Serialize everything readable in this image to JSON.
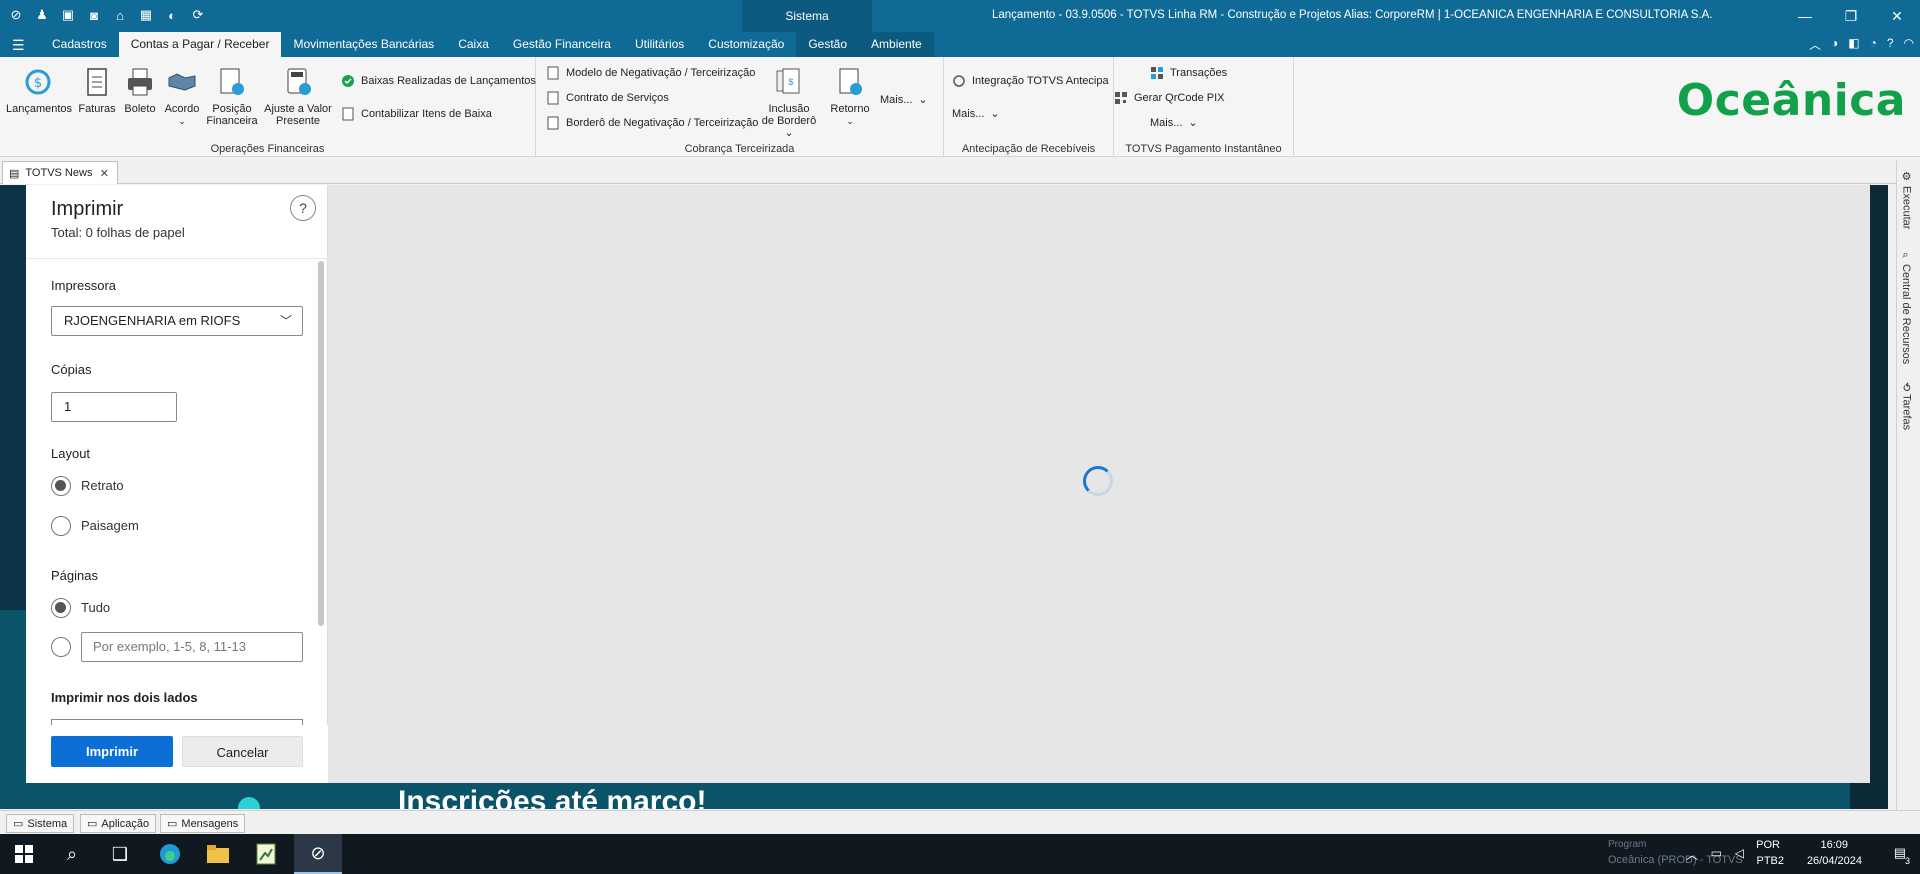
{
  "titlebar": {
    "sistema_label": "Sistema",
    "window_title": "Lançamento - 03.9.0506 - TOTVS Linha RM - Construção e Projetos  Alias: CorporeRM | 1-OCEANICA ENGENHARIA E CONSULTORIA S.A."
  },
  "menu": {
    "tabs": [
      "Cadastros",
      "Contas a Pagar / Receber",
      "Movimentações Bancárias",
      "Caixa",
      "Gestão Financeira",
      "Utilitários",
      "Customização",
      "Gestão",
      "Ambiente"
    ],
    "active_tab": "Contas a Pagar / Receber"
  },
  "ribbon": {
    "operacoes": {
      "title": "Operações Financeiras",
      "lancamentos": "Lançamentos",
      "faturas": "Faturas",
      "boleto": "Boleto",
      "acordo": "Acordo",
      "posicao_1": "Posição",
      "posicao_2": "Financeira",
      "ajuste_1": "Ajuste a Valor",
      "ajuste_2": "Presente",
      "baixas": "Baixas Realizadas de Lançamentos",
      "contabilizar": "Contabilizar Itens de Baixa"
    },
    "cobranca": {
      "title": "Cobrança Terceirizada",
      "modelo": "Modelo de Negativação / Terceirização",
      "contrato": "Contrato de Serviços",
      "bordero_neg": "Borderô de Negativação / Terceirização",
      "inclusao_1": "Inclusão",
      "inclusao_2": "de Borderô",
      "retorno": "Retorno",
      "mais": "Mais..."
    },
    "antecipacao": {
      "title": "Antecipação de Recebíveis",
      "integracao": "Integração TOTVS Antecipa",
      "mais": "Mais..."
    },
    "pix": {
      "title": "TOTVS Pagamento Instantâneo",
      "transacoes": "Transações",
      "qrcode": "Gerar QrCode PIX",
      "mais": "Mais..."
    },
    "logo": "Oceânica"
  },
  "doc_tab": {
    "label": "TOTVS News"
  },
  "background": {
    "banner_text": "Inscrições até março!"
  },
  "print_dialog": {
    "title": "Imprimir",
    "subtitle": "Total: 0 folhas de papel",
    "help": "?",
    "printer_label": "Impressora",
    "printer_value": "RJOENGENHARIA em RIOFS",
    "copies_label": "Cópias",
    "copies_value": "1",
    "layout_label": "Layout",
    "layout_portrait": "Retrato",
    "layout_landscape": "Paisagem",
    "layout_selected": "Retrato",
    "pages_label": "Páginas",
    "pages_all": "Tudo",
    "pages_placeholder": "Por exemplo, 1-5, 8, 11-13",
    "duplex_label": "Imprimir nos dois lados",
    "print_button": "Imprimir",
    "cancel_button": "Cancelar"
  },
  "right_rail": [
    "Executar",
    "Central de Recursos",
    "Tarefas"
  ],
  "statusbar": {
    "tabs": [
      "Sistema",
      "Aplicação",
      "Mensagens"
    ]
  },
  "taskbar": {
    "ghost_1": "Program",
    "ghost_2": "Oceânica (PROD) - TOTVS",
    "lang_1": "POR",
    "lang_2": "PTB2",
    "time": "16:09",
    "date": "26/04/2024",
    "notif_count": "3"
  },
  "colors": {
    "titlebar": "#0f6a96",
    "accent_button": "#0b6fd6",
    "logo_green": "#13a04b"
  }
}
